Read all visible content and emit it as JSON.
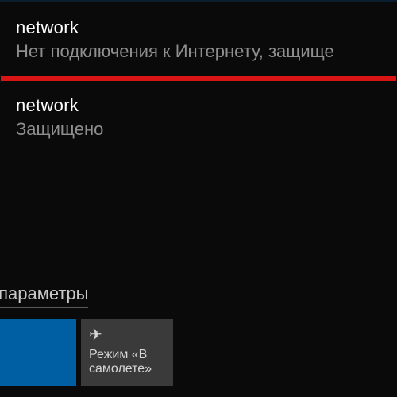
{
  "networks": [
    {
      "name": "network",
      "status": "Нет подключения к Интернету, защище"
    },
    {
      "name": "network",
      "status": "Защищено"
    }
  ],
  "footer": {
    "heading": "евые параметры",
    "tiles": {
      "wifi": {
        "label": ""
      },
      "airplane": {
        "label": "Режим «В самолете»"
      }
    }
  }
}
